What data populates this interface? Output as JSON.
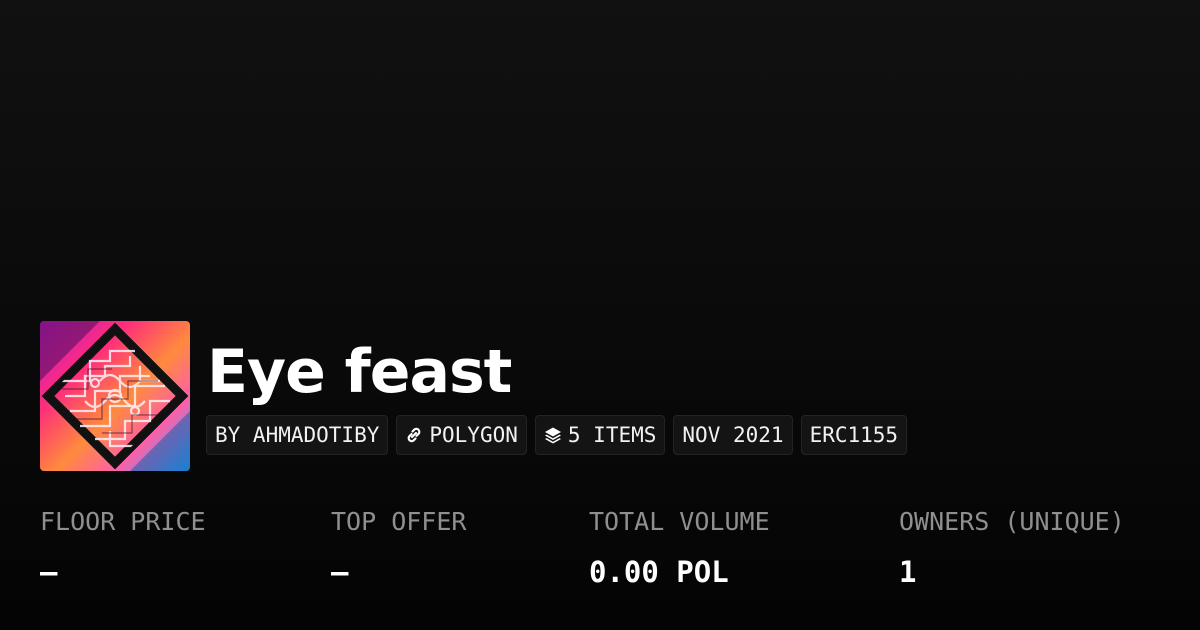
{
  "collection": {
    "title": "Eye feast",
    "image_alt": "collection-artwork"
  },
  "tags": {
    "creator": "BY AHMADOTIBY",
    "chain": "POLYGON",
    "chain_icon": "link-icon",
    "items": "5 ITEMS",
    "items_icon": "layers-icon",
    "date": "NOV 2021",
    "standard": "ERC1155"
  },
  "stats": {
    "floor_price": {
      "label": "FLOOR PRICE",
      "value": "—"
    },
    "top_offer": {
      "label": "TOP OFFER",
      "value": "—"
    },
    "total_volume": {
      "label": "TOTAL VOLUME",
      "value": "0.00 POL"
    },
    "owners": {
      "label": "OWNERS (UNIQUE)",
      "value": "1"
    }
  }
}
